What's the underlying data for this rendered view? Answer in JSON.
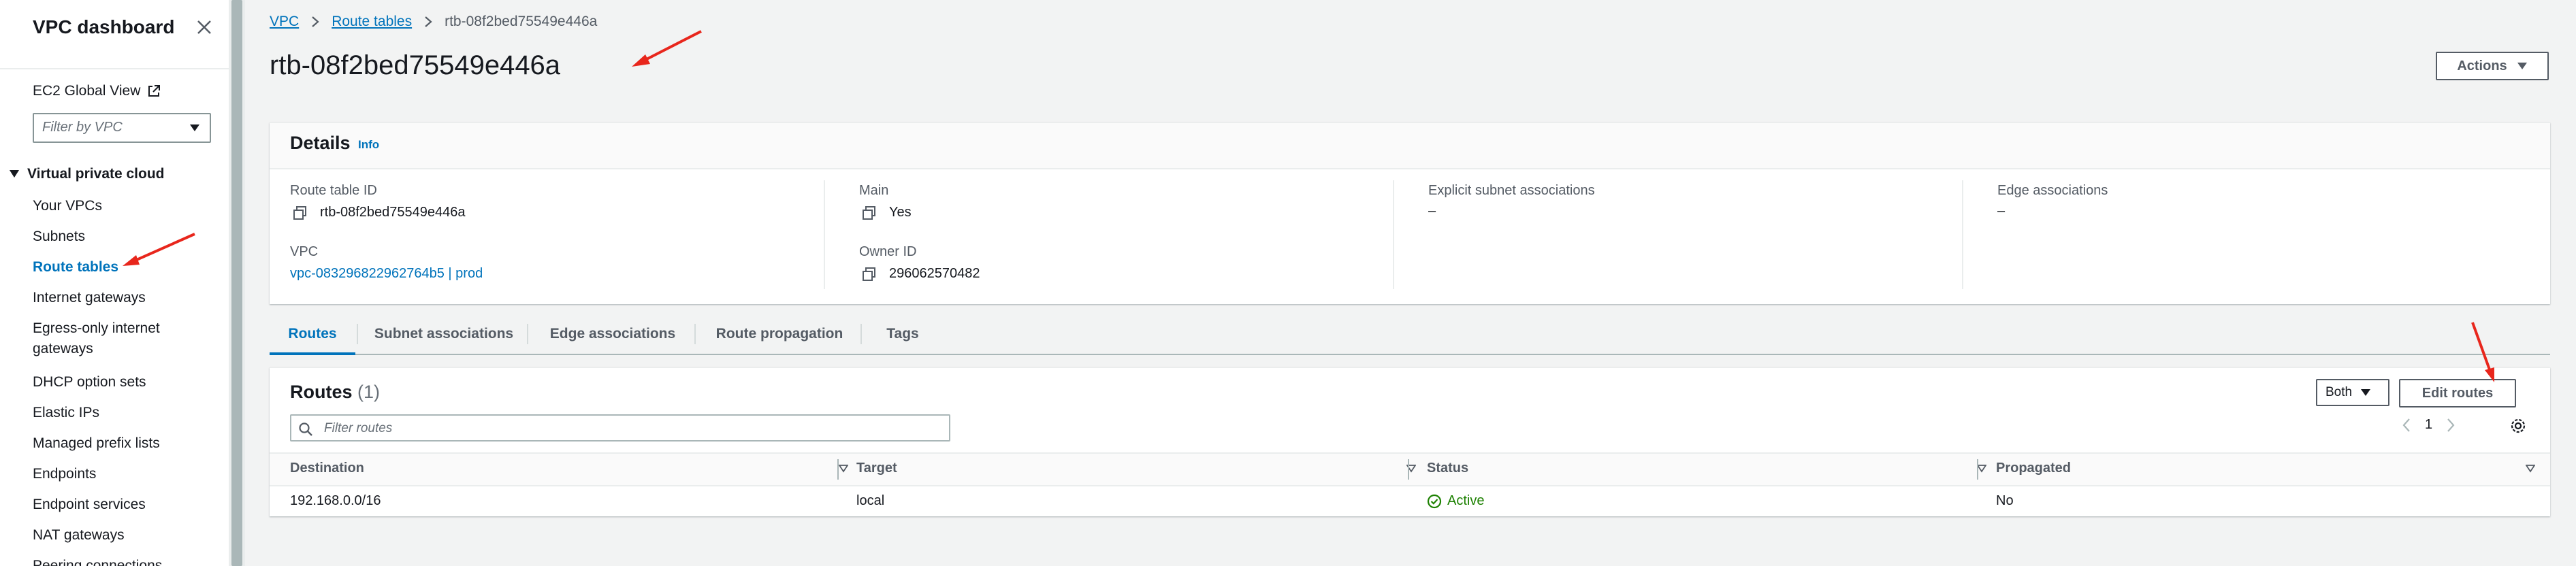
{
  "sidebar": {
    "title": "VPC dashboard",
    "ec2_global_view": "EC2 Global View",
    "filter_placeholder": "Filter by VPC",
    "section": "Virtual private cloud",
    "items": [
      {
        "label": "Your VPCs"
      },
      {
        "label": "Subnets"
      },
      {
        "label": "Route tables",
        "active": true
      },
      {
        "label": "Internet gateways"
      },
      {
        "label": "Egress-only internet gateways"
      },
      {
        "label": "DHCP option sets"
      },
      {
        "label": "Elastic IPs"
      },
      {
        "label": "Managed prefix lists"
      },
      {
        "label": "Endpoints"
      },
      {
        "label": "Endpoint services"
      },
      {
        "label": "NAT gateways"
      },
      {
        "label": "Peering connections"
      }
    ]
  },
  "breadcrumb": {
    "items": [
      "VPC",
      "Route tables",
      "rtb-08f2bed75549e446a"
    ]
  },
  "page": {
    "title": "rtb-08f2bed75549e446a",
    "actions_label": "Actions"
  },
  "details": {
    "title": "Details",
    "info": "Info",
    "route_table_id_label": "Route table ID",
    "route_table_id": "rtb-08f2bed75549e446a",
    "main_label": "Main",
    "main_value": "Yes",
    "explicit_label": "Explicit subnet associations",
    "explicit_value": "–",
    "edge_label": "Edge associations",
    "edge_value": "–",
    "vpc_label": "VPC",
    "vpc_value": "vpc-083296822962764b5 | prod",
    "owner_label": "Owner ID",
    "owner_value": "296062570482"
  },
  "tabs": [
    {
      "label": "Routes",
      "active": true
    },
    {
      "label": "Subnet associations"
    },
    {
      "label": "Edge associations"
    },
    {
      "label": "Route propagation"
    },
    {
      "label": "Tags"
    }
  ],
  "routes": {
    "title": "Routes",
    "count": "(1)",
    "filter_placeholder": "Filter routes",
    "both_label": "Both",
    "edit_label": "Edit routes",
    "page_number": "1",
    "columns": [
      "Destination",
      "Target",
      "Status",
      "Propagated"
    ],
    "rows": [
      {
        "destination": "192.168.0.0/16",
        "target": "local",
        "status": "Active",
        "propagated": "No"
      }
    ]
  },
  "icons": {
    "close": "close-icon",
    "external": "external-link-icon",
    "copy": "copy-icon",
    "search": "search-icon",
    "gear": "gear-icon",
    "check": "check-circle-icon",
    "annotation": "red-arrow-icon"
  },
  "colors": {
    "link": "#0073bb",
    "success": "#1d8102",
    "annotation": "#e8261c"
  }
}
